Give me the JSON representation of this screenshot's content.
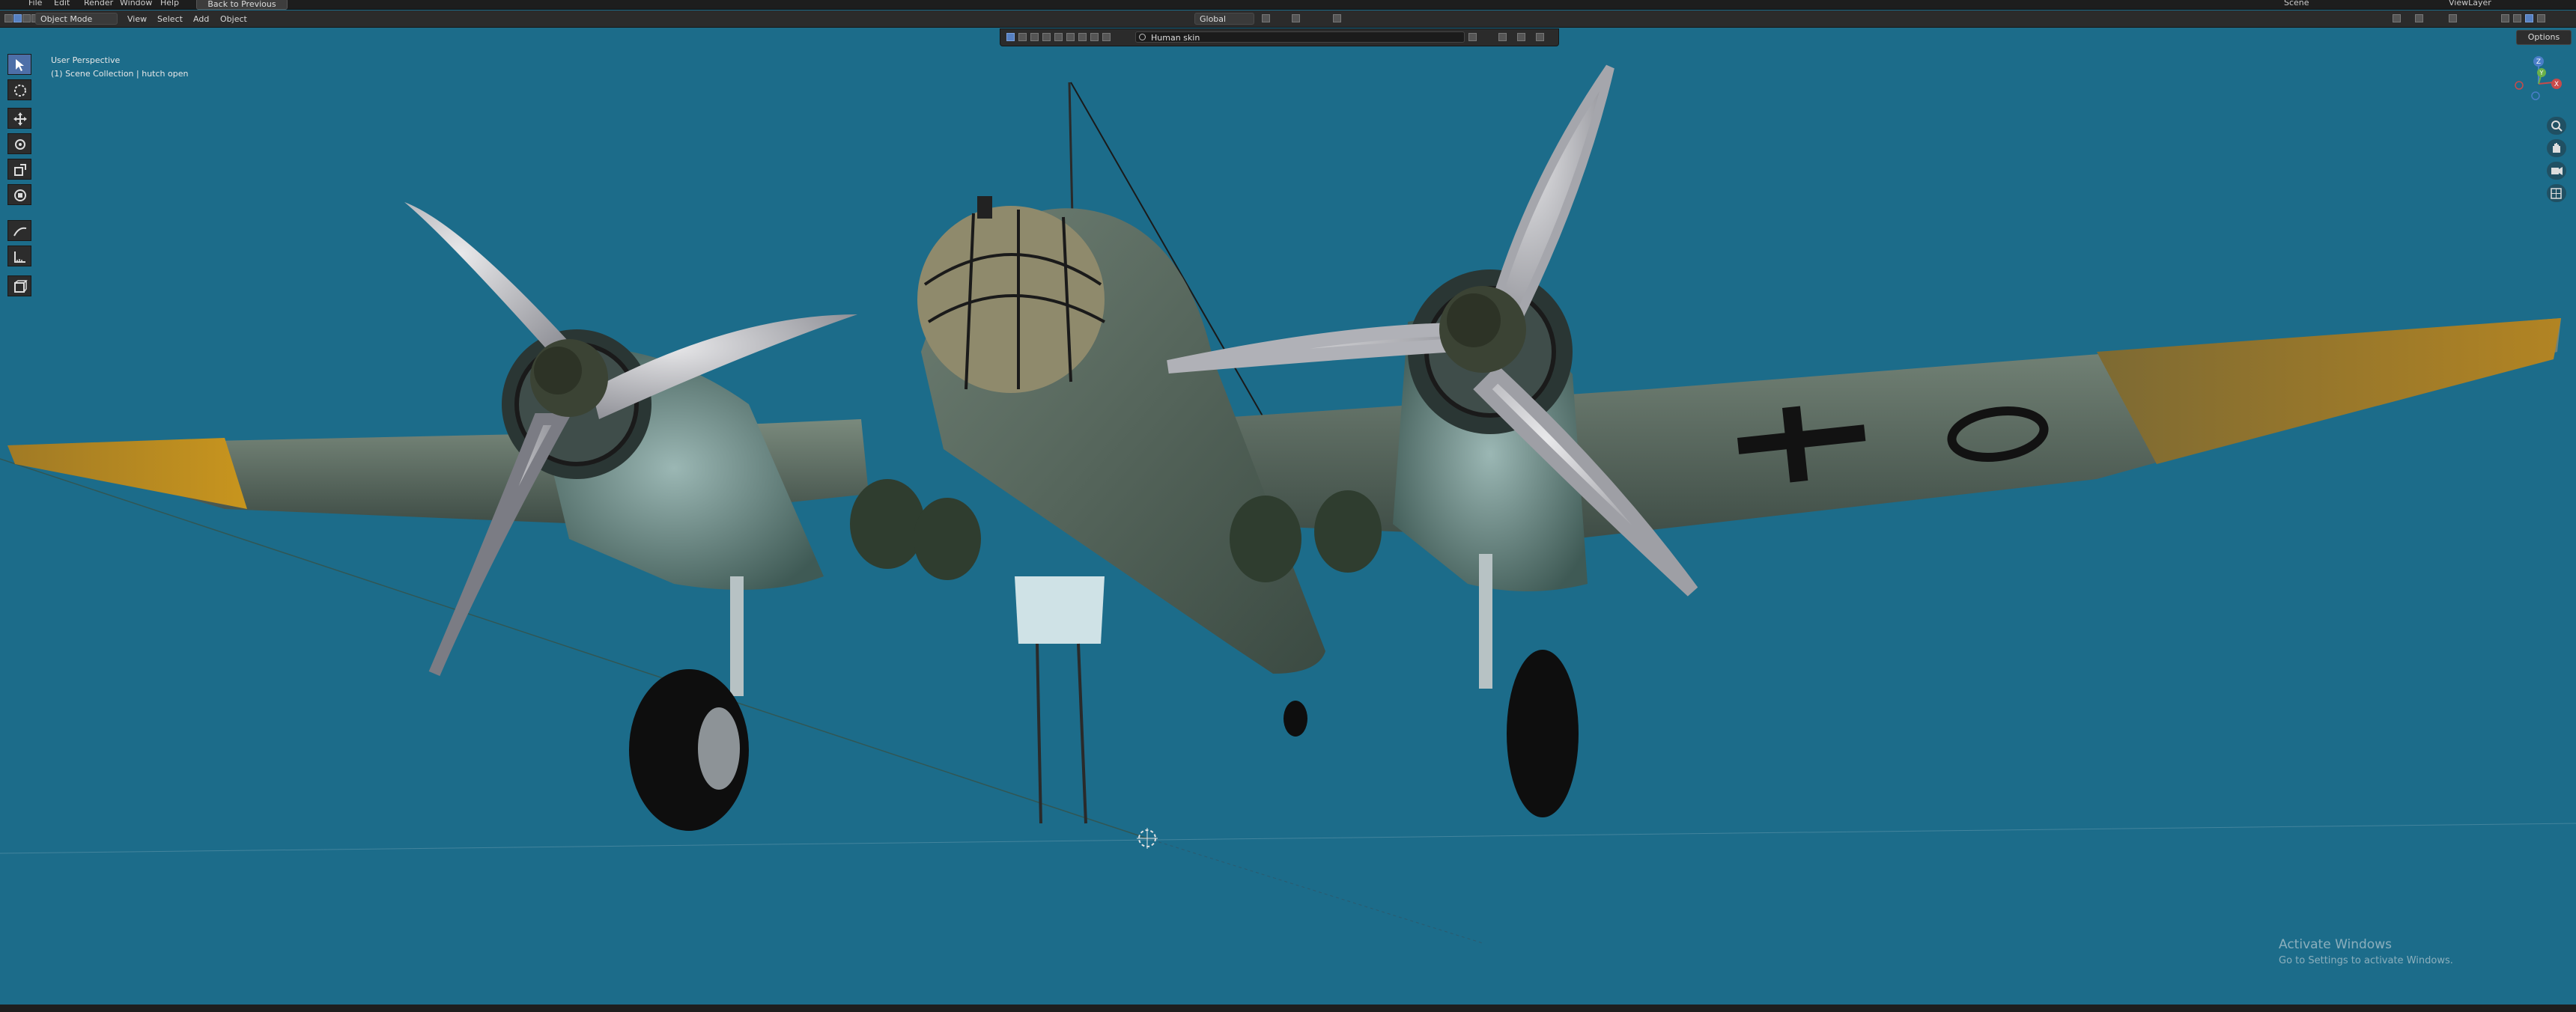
{
  "topbar": {
    "menus": [
      "File",
      "Edit",
      "Render",
      "Window",
      "Help"
    ],
    "back_button": "Back to Previous",
    "scene_name": "Scene",
    "view_layer": "ViewLayer"
  },
  "header": {
    "mode": "Object Mode",
    "menus": [
      "View",
      "Select",
      "Add",
      "Object"
    ],
    "transform_orientation": "Global"
  },
  "outliner_bar": {
    "search_value": "Human skin"
  },
  "viewport": {
    "perspective": "User Perspective",
    "collection": "(1) Scene Collection | hutch open",
    "options_label": "Options",
    "gizmo_axes": [
      "Z",
      "Y",
      "X"
    ]
  },
  "tools": [
    "select",
    "cursor",
    "move",
    "rotate",
    "scale",
    "transform",
    "annotate",
    "measure",
    "add-cube"
  ],
  "watermark": {
    "title": "Activate Windows",
    "subtitle": "Go to Settings to activate Windows."
  },
  "colors": {
    "viewport_bg": "#1c6c8a",
    "header_bg": "#2b2b2b",
    "accent": "#4d6fa8"
  }
}
